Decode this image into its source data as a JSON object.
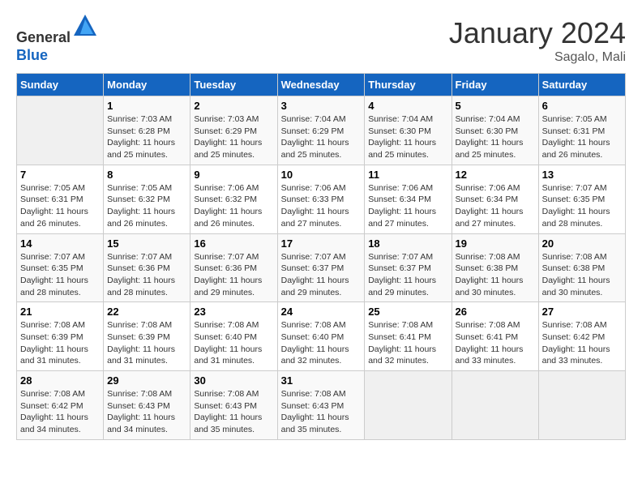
{
  "header": {
    "logo_line1": "General",
    "logo_line2": "Blue",
    "month": "January 2024",
    "location": "Sagalo, Mali"
  },
  "weekdays": [
    "Sunday",
    "Monday",
    "Tuesday",
    "Wednesday",
    "Thursday",
    "Friday",
    "Saturday"
  ],
  "weeks": [
    [
      {
        "day": "",
        "info": ""
      },
      {
        "day": "1",
        "info": "Sunrise: 7:03 AM\nSunset: 6:28 PM\nDaylight: 11 hours\nand 25 minutes."
      },
      {
        "day": "2",
        "info": "Sunrise: 7:03 AM\nSunset: 6:29 PM\nDaylight: 11 hours\nand 25 minutes."
      },
      {
        "day": "3",
        "info": "Sunrise: 7:04 AM\nSunset: 6:29 PM\nDaylight: 11 hours\nand 25 minutes."
      },
      {
        "day": "4",
        "info": "Sunrise: 7:04 AM\nSunset: 6:30 PM\nDaylight: 11 hours\nand 25 minutes."
      },
      {
        "day": "5",
        "info": "Sunrise: 7:04 AM\nSunset: 6:30 PM\nDaylight: 11 hours\nand 25 minutes."
      },
      {
        "day": "6",
        "info": "Sunrise: 7:05 AM\nSunset: 6:31 PM\nDaylight: 11 hours\nand 26 minutes."
      }
    ],
    [
      {
        "day": "7",
        "info": "Sunrise: 7:05 AM\nSunset: 6:31 PM\nDaylight: 11 hours\nand 26 minutes."
      },
      {
        "day": "8",
        "info": "Sunrise: 7:05 AM\nSunset: 6:32 PM\nDaylight: 11 hours\nand 26 minutes."
      },
      {
        "day": "9",
        "info": "Sunrise: 7:06 AM\nSunset: 6:32 PM\nDaylight: 11 hours\nand 26 minutes."
      },
      {
        "day": "10",
        "info": "Sunrise: 7:06 AM\nSunset: 6:33 PM\nDaylight: 11 hours\nand 27 minutes."
      },
      {
        "day": "11",
        "info": "Sunrise: 7:06 AM\nSunset: 6:34 PM\nDaylight: 11 hours\nand 27 minutes."
      },
      {
        "day": "12",
        "info": "Sunrise: 7:06 AM\nSunset: 6:34 PM\nDaylight: 11 hours\nand 27 minutes."
      },
      {
        "day": "13",
        "info": "Sunrise: 7:07 AM\nSunset: 6:35 PM\nDaylight: 11 hours\nand 28 minutes."
      }
    ],
    [
      {
        "day": "14",
        "info": "Sunrise: 7:07 AM\nSunset: 6:35 PM\nDaylight: 11 hours\nand 28 minutes."
      },
      {
        "day": "15",
        "info": "Sunrise: 7:07 AM\nSunset: 6:36 PM\nDaylight: 11 hours\nand 28 minutes."
      },
      {
        "day": "16",
        "info": "Sunrise: 7:07 AM\nSunset: 6:36 PM\nDaylight: 11 hours\nand 29 minutes."
      },
      {
        "day": "17",
        "info": "Sunrise: 7:07 AM\nSunset: 6:37 PM\nDaylight: 11 hours\nand 29 minutes."
      },
      {
        "day": "18",
        "info": "Sunrise: 7:07 AM\nSunset: 6:37 PM\nDaylight: 11 hours\nand 29 minutes."
      },
      {
        "day": "19",
        "info": "Sunrise: 7:08 AM\nSunset: 6:38 PM\nDaylight: 11 hours\nand 30 minutes."
      },
      {
        "day": "20",
        "info": "Sunrise: 7:08 AM\nSunset: 6:38 PM\nDaylight: 11 hours\nand 30 minutes."
      }
    ],
    [
      {
        "day": "21",
        "info": "Sunrise: 7:08 AM\nSunset: 6:39 PM\nDaylight: 11 hours\nand 31 minutes."
      },
      {
        "day": "22",
        "info": "Sunrise: 7:08 AM\nSunset: 6:39 PM\nDaylight: 11 hours\nand 31 minutes."
      },
      {
        "day": "23",
        "info": "Sunrise: 7:08 AM\nSunset: 6:40 PM\nDaylight: 11 hours\nand 31 minutes."
      },
      {
        "day": "24",
        "info": "Sunrise: 7:08 AM\nSunset: 6:40 PM\nDaylight: 11 hours\nand 32 minutes."
      },
      {
        "day": "25",
        "info": "Sunrise: 7:08 AM\nSunset: 6:41 PM\nDaylight: 11 hours\nand 32 minutes."
      },
      {
        "day": "26",
        "info": "Sunrise: 7:08 AM\nSunset: 6:41 PM\nDaylight: 11 hours\nand 33 minutes."
      },
      {
        "day": "27",
        "info": "Sunrise: 7:08 AM\nSunset: 6:42 PM\nDaylight: 11 hours\nand 33 minutes."
      }
    ],
    [
      {
        "day": "28",
        "info": "Sunrise: 7:08 AM\nSunset: 6:42 PM\nDaylight: 11 hours\nand 34 minutes."
      },
      {
        "day": "29",
        "info": "Sunrise: 7:08 AM\nSunset: 6:43 PM\nDaylight: 11 hours\nand 34 minutes."
      },
      {
        "day": "30",
        "info": "Sunrise: 7:08 AM\nSunset: 6:43 PM\nDaylight: 11 hours\nand 35 minutes."
      },
      {
        "day": "31",
        "info": "Sunrise: 7:08 AM\nSunset: 6:43 PM\nDaylight: 11 hours\nand 35 minutes."
      },
      {
        "day": "",
        "info": ""
      },
      {
        "day": "",
        "info": ""
      },
      {
        "day": "",
        "info": ""
      }
    ]
  ]
}
